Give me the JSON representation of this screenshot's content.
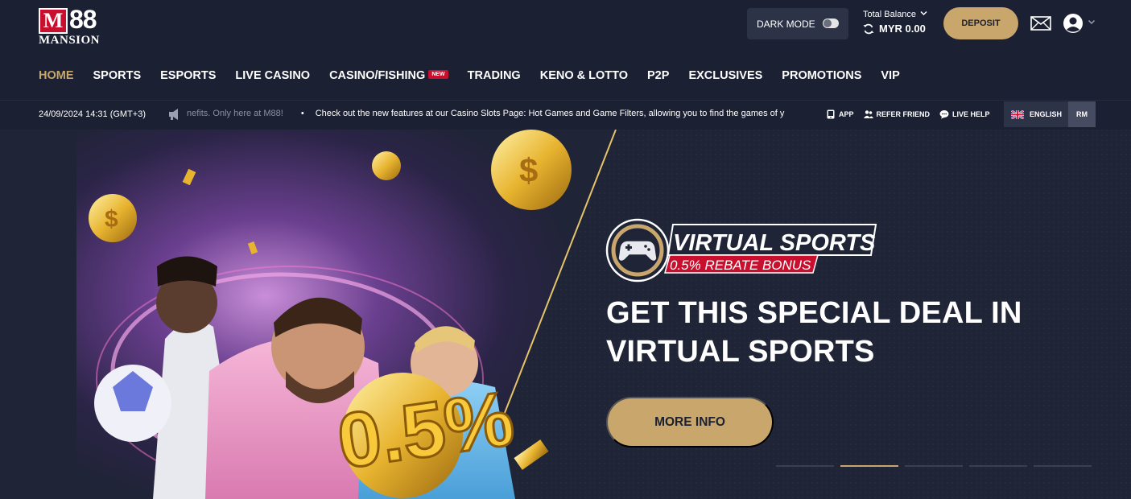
{
  "brand": {
    "logo_m": "M",
    "logo_88": "88",
    "logo_mansion": "MANSION"
  },
  "header": {
    "dark_mode_label": "DARK MODE",
    "balance_label": "Total Balance",
    "balance_value": "MYR 0.00",
    "deposit_label": "DEPOSIT"
  },
  "nav": {
    "items": [
      {
        "label": "HOME",
        "active": true
      },
      {
        "label": "SPORTS"
      },
      {
        "label": "ESPORTS"
      },
      {
        "label": "LIVE CASINO"
      },
      {
        "label": "CASINO/FISHING",
        "badge": "NEW"
      },
      {
        "label": "TRADING"
      },
      {
        "label": "KENO & LOTTO"
      },
      {
        "label": "P2P"
      },
      {
        "label": "EXCLUSIVES"
      },
      {
        "label": "PROMOTIONS"
      },
      {
        "label": "VIP"
      }
    ]
  },
  "ticker": {
    "datetime": "24/09/2024 14:31 (GMT+3)",
    "message_1": "nefits. Only here at M88!",
    "message_2": "Check out the new features at our Casino Slots Page: Hot Games and Game Filters, allowing you to find the games of y",
    "links": {
      "app": "APP",
      "refer": "REFER FRIEND",
      "help": "LIVE HELP"
    },
    "language": "ENGLISH",
    "currency": "RM"
  },
  "banner": {
    "badge_title": "VIRTUAL SPORTS",
    "badge_subtitle": "0.5% REBATE BONUS",
    "art_text": "0.5%",
    "headline_line1": "GET THIS SPECIAL DEAL IN",
    "headline_line2": "VIRTUAL SPORTS",
    "cta_label": "MORE INFO",
    "slides_total": 5,
    "slide_active": 2
  },
  "colors": {
    "bg": "#1b2032",
    "gold": "#c9a66b",
    "red": "#c8102e",
    "panel": "#2d3347"
  }
}
